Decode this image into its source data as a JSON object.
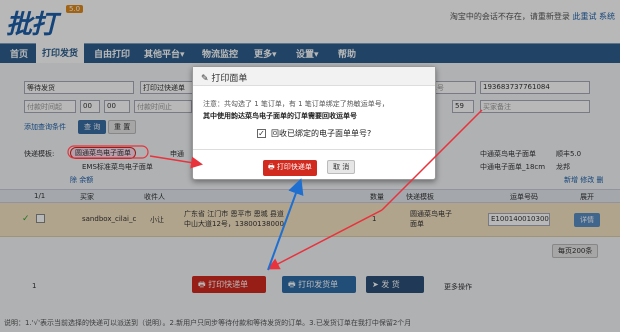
{
  "header": {
    "logo": "批打",
    "version": "5.0",
    "hint_prefix": "淘宝中的会话不存在，请重新登录",
    "hint_link1": "此重试",
    "hint_link2": "系统"
  },
  "nav": {
    "items": [
      "首页",
      "打印发货",
      "自由打印",
      "其他平台▾",
      "物流监控",
      "更多▾",
      "设置▾",
      "帮助"
    ]
  },
  "filters": {
    "status": "等待发货",
    "print_status": "打印过快递单",
    "search_placeholder": "运单号",
    "order_no": "193683737761084",
    "pay_time_placeholder": "付款时间起",
    "hour1": "00",
    "min1": "00",
    "pay_time_end_placeholder": "付款时间止",
    "min_end": "59",
    "remark_placeholder": "买家备注",
    "add_condition": "添加查询条件",
    "search_btn": "查 询",
    "reset_btn": "重 置"
  },
  "express": {
    "label": "快递模板:",
    "opt_selected": "圆通菜鸟电子面单",
    "opt2": "申通",
    "opt3": "EMS标准菜鸟电子面单",
    "opt4": "中通菜鸟电子面单",
    "opt5": "顺丰5.0",
    "opt6": "中通电子面单_18cm",
    "opt7": "龙邦",
    "actions": "新增 修改 删",
    "extra": "除 余额"
  },
  "table": {
    "pager": "1/1",
    "cols": [
      "买家",
      "收件人",
      "数量",
      "快递模板",
      "运单号码",
      "展开"
    ],
    "row": {
      "buyer": "sandbox_cilai_c",
      "receiver": "小让",
      "address": "广东省 江门市 恩平市 恩城 县道中山大道12号，13800138000",
      "qty": "1",
      "template": "圆通菜鸟电子面单",
      "waybill": "E100140010300",
      "detail": "详情"
    },
    "page_size": "每页200条"
  },
  "bottom": {
    "page_num": "1",
    "print_express": "打印快递单",
    "print_invoice": "打印发货单",
    "ship": "发 货",
    "more": "更多操作",
    "note": "说明：1.'√'表示当前选择的快递可以派送到（说明）。2.新用户只同步等待付款和等待发货的订单。3.已发货订单在我打中保留2个月"
  },
  "dialog": {
    "title": "打印面单",
    "notice": "注意：共勾选了 1 笔订单，有 1 笔订单绑定了热敏运单号，",
    "notice_bold": "其中使用韵达菜鸟电子面单的订单需要回收运单号",
    "checkbox_label": "回收已绑定的电子面单单号?",
    "print_btn": "打印快递单",
    "cancel_btn": "取 消"
  },
  "colors": {
    "nav": "#2f5f8e",
    "print_btn": "#d12a1f",
    "arrow": "#e8323c",
    "blue_arrow": "#1e6fd0"
  }
}
